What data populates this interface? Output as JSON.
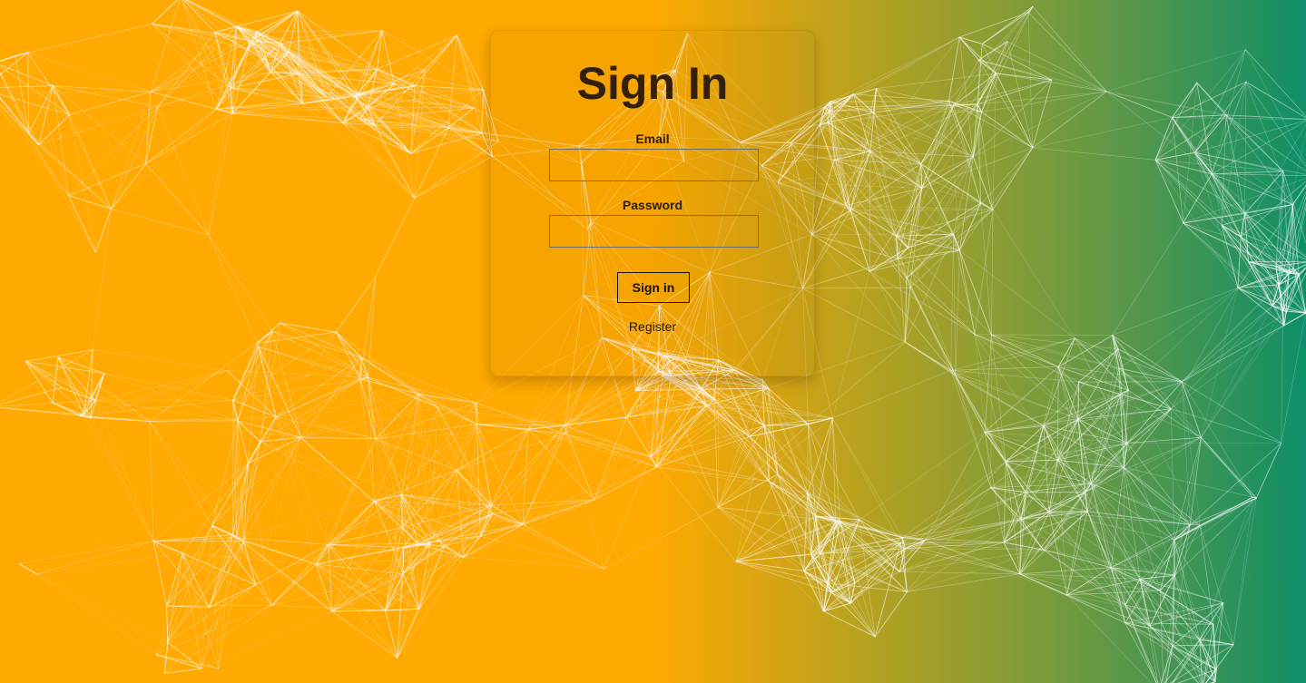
{
  "background": {
    "gradient_colors": [
      "#FFA901",
      "#0E8F68"
    ],
    "line_color": "#FFFFFF"
  },
  "login_card": {
    "title": "Sign In",
    "email_label": "Email",
    "email_value": "",
    "password_label": "Password",
    "password_value": "",
    "submit_label": "Sign in",
    "register_link": "Register"
  }
}
